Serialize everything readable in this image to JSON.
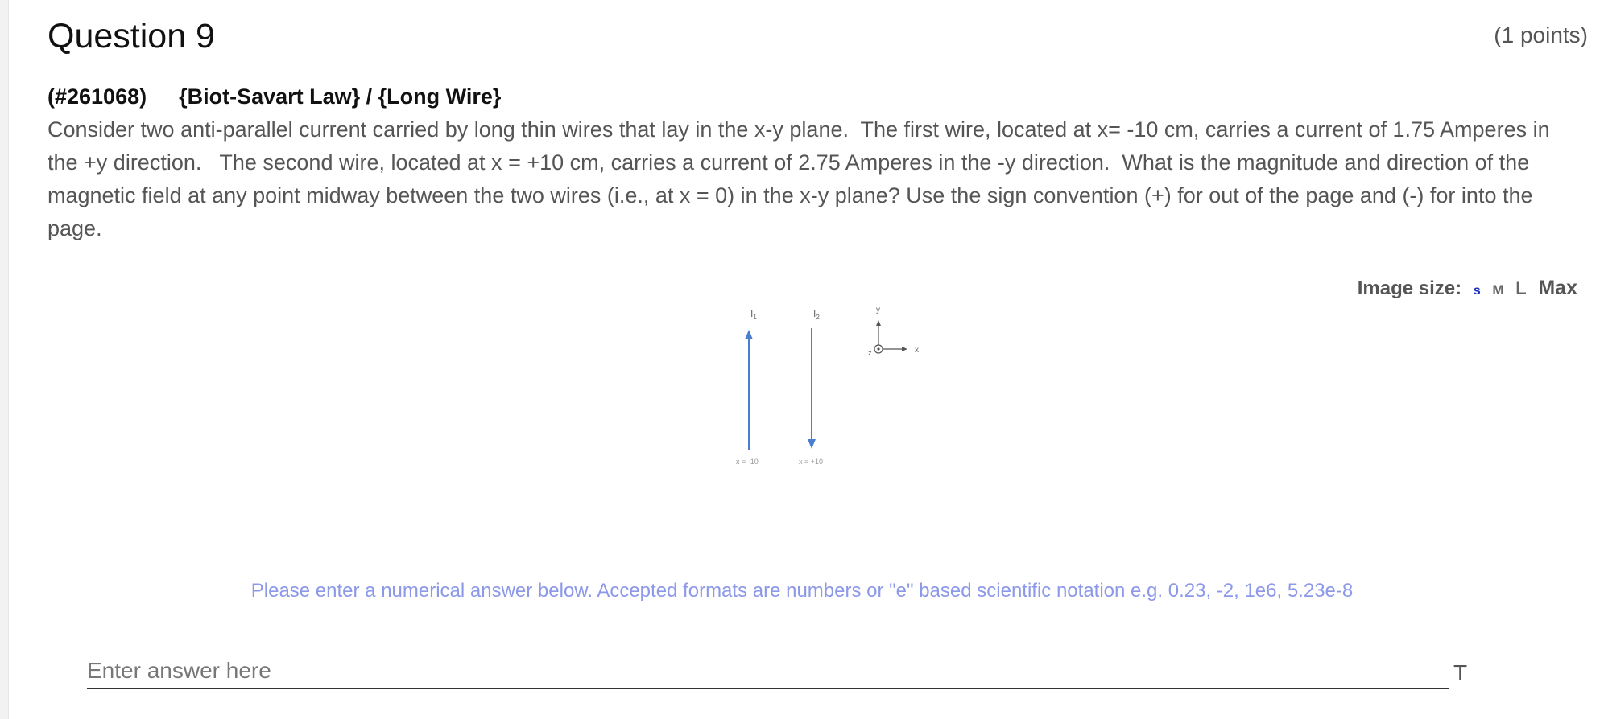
{
  "question": {
    "title": "Question 9",
    "points": "(1 points)",
    "id": "(#261068)",
    "topic": "{Biot-Savart Law} / {Long Wire}",
    "text": "Consider two anti-parallel current carried by long thin wires that lay in the x-y plane.  The first wire, located at x= -10 cm, carries a current of 1.75 Amperes in the +y direction.   The second wire, located at x = +10 cm, carries a current of 2.75 Amperes in the -y direction.  What is the magnitude and direction of the magnetic field at any point midway between the two wires (i.e., at x = 0) in the x-y plane? Use the sign convention (+) for out of the page and (-) for into the page."
  },
  "image_size": {
    "label": "Image size:",
    "options": [
      "s",
      "M",
      "L",
      "Max"
    ],
    "selected": "s"
  },
  "figure": {
    "wire1_label": "I",
    "wire1_sub": "1",
    "wire2_label": "I",
    "wire2_sub": "2",
    "wire1_pos": "x = -10",
    "wire2_pos": "x = +10",
    "axis_y": "y",
    "axis_x": "x",
    "axis_z": "z",
    "wire_color": "#4a7fcf"
  },
  "answer": {
    "hint": "Please enter a numerical answer below. Accepted formats are numbers or \"e\" based scientific notation e.g. 0.23, -2, 1e6, 5.23e-8",
    "placeholder": "Enter answer here",
    "value": "",
    "format_icon": "T"
  }
}
